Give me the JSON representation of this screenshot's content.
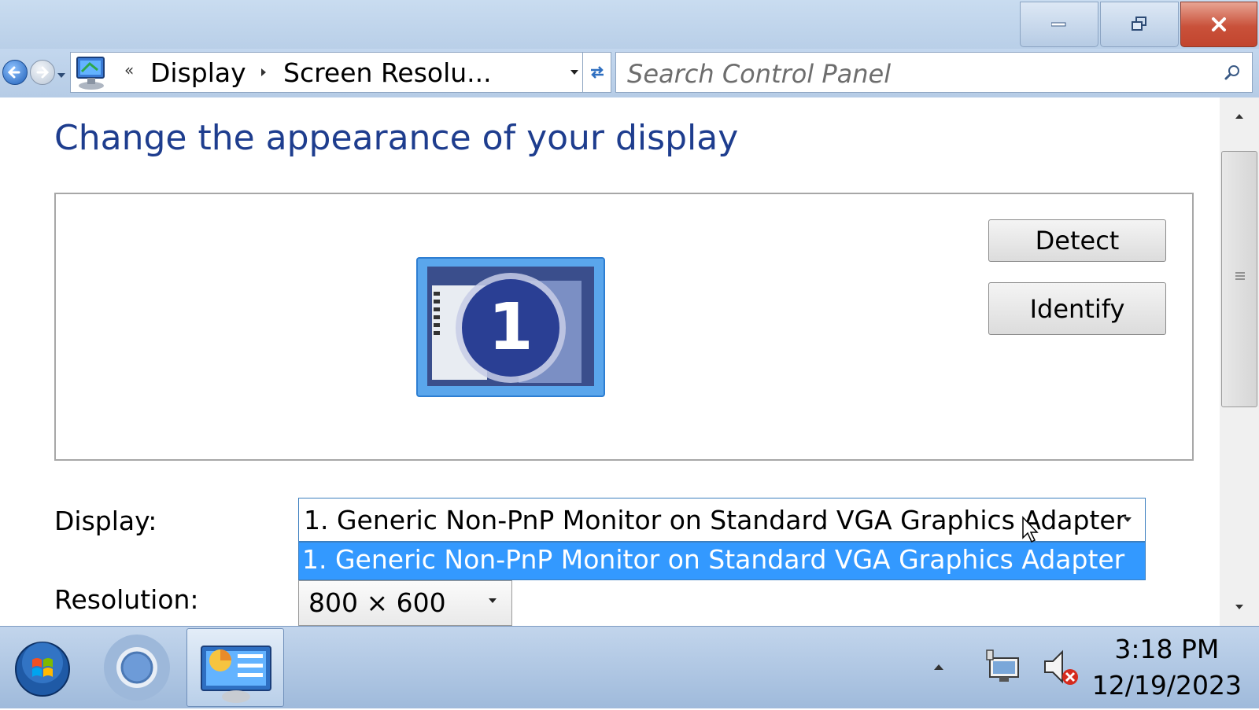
{
  "window": {
    "minimize_label": "Minimize",
    "restore_label": "Restore Down",
    "close_label": "Close"
  },
  "nav": {
    "breadcrumb_overflow": "«",
    "breadcrumb": [
      "Display",
      "Screen Resolu..."
    ],
    "search_placeholder": "Search Control Panel"
  },
  "page": {
    "title": "Change the appearance of your display",
    "monitor_number": "1",
    "detect_label": "Detect",
    "identify_label": "Identify",
    "display_label": "Display:",
    "display_value": "1. Generic Non-PnP Monitor on Standard VGA Graphics Adapter",
    "display_options": [
      "1. Generic Non-PnP Monitor on Standard VGA Graphics Adapter"
    ],
    "resolution_label": "Resolution:",
    "resolution_value": "800 × 600"
  },
  "taskbar": {
    "time": "3:18 PM",
    "date": "12/19/2023",
    "pinned": [
      "start-orb",
      "chrome",
      "display-control-panel"
    ]
  },
  "colors": {
    "title_text": "#1e3d8e",
    "selection": "#3399ff",
    "close_button": "#c9513a"
  }
}
